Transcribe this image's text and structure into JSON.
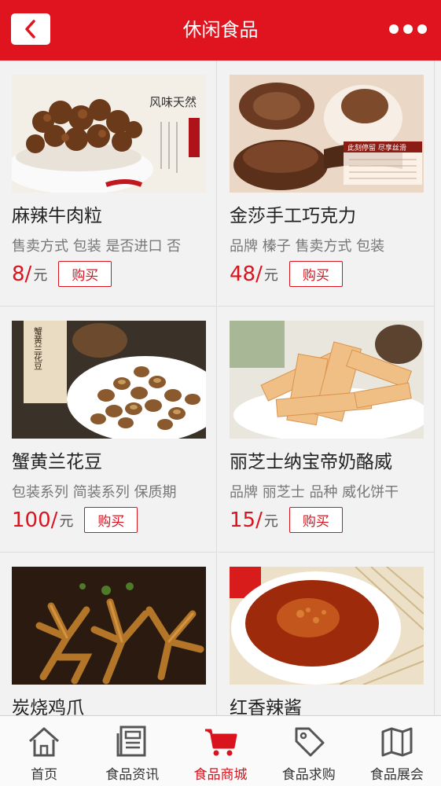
{
  "header": {
    "title": "休闲食品"
  },
  "products": [
    {
      "name": "麻辣牛肉粒",
      "attrs": "售卖方式 包装 是否进口 否",
      "price": "8/",
      "unit": "元",
      "buy": "购买"
    },
    {
      "name": "金莎手工巧克力",
      "attrs": "品牌 榛子 售卖方式 包装",
      "price": "48/",
      "unit": "元",
      "buy": "购买"
    },
    {
      "name": "蟹黄兰花豆",
      "attrs": "包装系列 简装系列 保质期",
      "price": "100/",
      "unit": "元",
      "buy": "购买"
    },
    {
      "name": "丽芝士纳宝帝奶酪威",
      "attrs": "品牌 丽芝士 品种 威化饼干",
      "price": "15/",
      "unit": "元",
      "buy": "购买"
    },
    {
      "name": "炭烧鸡爪",
      "attrs": "",
      "price": "",
      "unit": "",
      "buy": ""
    },
    {
      "name": "红香辣酱",
      "attrs": "",
      "price": "",
      "unit": "",
      "buy": ""
    }
  ],
  "image_text": {
    "p1_calligraphy": "风味天然",
    "p2_banner_title": "此刻停留 尽享丝滑",
    "p3_vertical": "蟹黄兰花豆"
  },
  "tabs": [
    {
      "label": "首页",
      "icon": "home-icon"
    },
    {
      "label": "食品资讯",
      "icon": "news-icon"
    },
    {
      "label": "食品商城",
      "icon": "cart-icon",
      "active": true
    },
    {
      "label": "食品求购",
      "icon": "tag-icon"
    },
    {
      "label": "食品展会",
      "icon": "map-icon"
    }
  ],
  "colors": {
    "brand": "#e0141e",
    "price": "#d9141e"
  }
}
